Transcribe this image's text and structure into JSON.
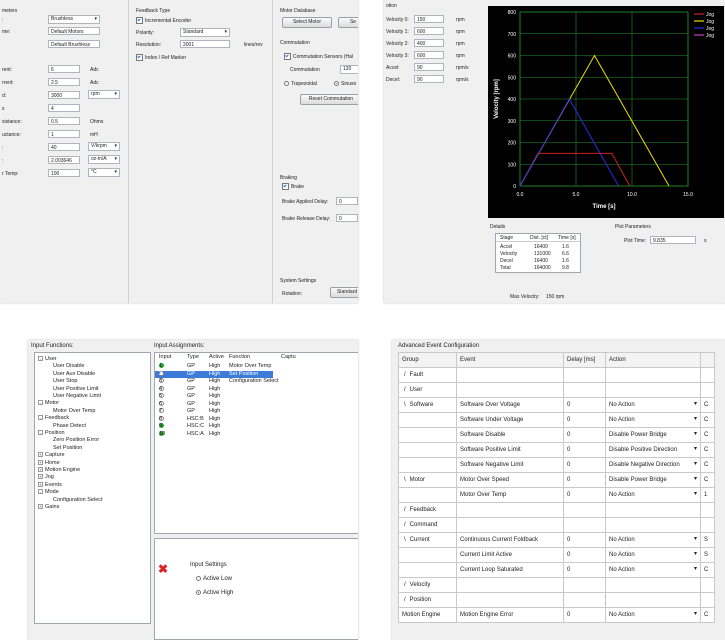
{
  "motor": {
    "parameters_header": "meters",
    "left_labels": [
      ":",
      "me:",
      "rent:",
      "rrent:",
      "d:",
      "s",
      "sistance:",
      "uctance:",
      ":",
      ":",
      "r Temp:"
    ],
    "fields": {
      "type": "Brushless",
      "name": "Default Motors",
      "model": "Default Brushless",
      "peak_current": "6",
      "cont_current": "2.5",
      "speed": "3000",
      "poles": "4",
      "resistance": "0.5",
      "inductance": "1",
      "ke": "40",
      "kt": "2.003646",
      "temp": "100"
    },
    "units": {
      "peak_current": "Adc",
      "cont_current": "Adc",
      "speed": "rpm",
      "resistance": "Ohms",
      "inductance": "mH",
      "ke": "V/krpm",
      "kt": "oz-in/A",
      "temp": "°C"
    },
    "feedback": {
      "header": "Feedback Type",
      "encoder_label": "Incremental Encoder",
      "polarity_label": "Polarity:",
      "polarity_value": "Standard",
      "resolution_label": "Resolution:",
      "resolution_value": "2001",
      "resolution_unit": "lines/rev",
      "index_label": "Index / Ref Marker"
    },
    "database": {
      "header": "Motor Database",
      "select_button": "Select Motor",
      "second_button": "Se"
    },
    "commutation": {
      "header": "Commutation",
      "sensors_label": "Commutation Sensors (Hal",
      "commutation_label": "Commutation",
      "commutation_value": "120",
      "trap_label": "Trapezoidal",
      "sin_label": "Sinuso",
      "reset_button": "Reset Commutation"
    },
    "braking": {
      "header": "Braking",
      "brake_label": "Brake",
      "applied_label": "Brake Applied Delay:",
      "applied_value": "0",
      "release_label": "Brake Release Delay:",
      "release_value": "0"
    },
    "system": {
      "header": "System Settings",
      "rotation_label": "Rotation:",
      "rotation_value": "Standard"
    }
  },
  "profile": {
    "header": "otion",
    "rows": [
      {
        "label": "Velocity 0:",
        "value": "150",
        "unit": "rpm"
      },
      {
        "label": "Velocity 1:",
        "value": "600",
        "unit": "rpm"
      },
      {
        "label": "Velocity 2:",
        "value": "400",
        "unit": "rpm"
      },
      {
        "label": "Velocity 3:",
        "value": "600",
        "unit": "rpm"
      },
      {
        "label": "Accel:",
        "value": "90",
        "unit": "rpm/s"
      },
      {
        "label": "Decel:",
        "value": "90",
        "unit": "rpm/s"
      }
    ],
    "details": {
      "header": "Details",
      "columns": [
        "Stage",
        "Dist. [ct]",
        "Time [s]"
      ],
      "rows": [
        [
          "Accel",
          "16400",
          "1.6"
        ],
        [
          "Velocity",
          "131000",
          "6.6"
        ],
        [
          "Decel",
          "16400",
          "1.6"
        ],
        [
          "Total",
          "164000",
          "9.8"
        ]
      ],
      "max_velocity_label": "Max Velocity:",
      "max_velocity_value": "150 rpm"
    },
    "plot_params": {
      "header": "Plot Parameters",
      "plot_time_label": "Plot Time:",
      "plot_time_value": "9.835",
      "plot_time_unit": "s"
    },
    "colors": {
      "plot_bg": "#000000",
      "grid": "#1f8f2a",
      "red": "#d02020",
      "yellow": "#e6e000",
      "blue": "#2a2ae6",
      "purple": "#c040c0"
    }
  },
  "chart_data": {
    "type": "line",
    "xlabel": "Time [s]",
    "ylabel": "Velocity [rpm]",
    "xlim": [
      0,
      15
    ],
    "ylim": [
      0,
      800
    ],
    "xticks": [
      "0.0",
      "5.0",
      "10.0",
      "15.0"
    ],
    "yticks": [
      "0",
      "100",
      "200",
      "300",
      "400",
      "500",
      "600",
      "700",
      "800"
    ],
    "grid": true,
    "legend_position": "top-right",
    "series": [
      {
        "name": "Jog",
        "color": "#d02020",
        "x": [
          0,
          1.6,
          8.2,
          9.8
        ],
        "y": [
          0,
          150,
          150,
          0
        ]
      },
      {
        "name": "Jog",
        "color": "#e6e000",
        "x": [
          0,
          6.65,
          13.3
        ],
        "y": [
          0,
          600,
          0
        ]
      },
      {
        "name": "Jog",
        "color": "#2a2ae6",
        "x": [
          0,
          4.4,
          8.8
        ],
        "y": [
          0,
          400,
          0
        ]
      },
      {
        "name": "Jog",
        "color": "#c040c0",
        "x": [],
        "y": []
      }
    ]
  },
  "io": {
    "functions_header": "Input Functions:",
    "assignments_header": "Input Assignments:",
    "tree": [
      {
        "label": "User",
        "level": 0,
        "exp": "-"
      },
      {
        "label": "User Disable",
        "level": 1
      },
      {
        "label": "User Aux Disable",
        "level": 1
      },
      {
        "label": "User Stop",
        "level": 1
      },
      {
        "label": "User Positive Limit",
        "level": 1
      },
      {
        "label": "User Negative Limit",
        "level": 1
      },
      {
        "label": "Motor",
        "level": 0,
        "exp": "-"
      },
      {
        "label": "Motor Over Temp",
        "level": 1
      },
      {
        "label": "Feedback",
        "level": 0,
        "exp": "-"
      },
      {
        "label": "Phase Detect",
        "level": 1
      },
      {
        "label": "Position",
        "level": 0,
        "exp": "-"
      },
      {
        "label": "Zero Position Error",
        "level": 1
      },
      {
        "label": "Set Position",
        "level": 1
      },
      {
        "label": "Capture",
        "level": 0,
        "exp": "+"
      },
      {
        "label": "Home",
        "level": 0,
        "exp": "+"
      },
      {
        "label": "Motion Engine",
        "level": 0,
        "exp": "+"
      },
      {
        "label": "Jog",
        "level": 0,
        "exp": "+"
      },
      {
        "label": "Events",
        "level": 0,
        "exp": "+"
      },
      {
        "label": "Mode",
        "level": 0,
        "exp": "-"
      },
      {
        "label": "Configuration Select",
        "level": 1
      },
      {
        "label": "Gains",
        "level": 0,
        "exp": "+"
      }
    ],
    "columns": [
      "Input",
      "Type",
      "Active",
      "Function",
      "Captu"
    ],
    "rows": [
      {
        "input": "1",
        "type": "GP",
        "active": "High",
        "function": "Motor Over Temp",
        "led": "green"
      },
      {
        "input": "2",
        "type": "GP",
        "active": "High",
        "function": "Set Position",
        "led": "off",
        "selected": true
      },
      {
        "input": "3",
        "type": "GP",
        "active": "High",
        "function": "Configuration Select",
        "led": "off"
      },
      {
        "input": "4",
        "type": "GP",
        "active": "High",
        "function": "",
        "led": "off"
      },
      {
        "input": "5",
        "type": "GP",
        "active": "High",
        "function": "",
        "led": "off"
      },
      {
        "input": "6",
        "type": "GP",
        "active": "High",
        "function": "",
        "led": "off"
      },
      {
        "input": "7",
        "type": "GP",
        "active": "High",
        "function": "",
        "led": "off"
      },
      {
        "input": "8",
        "type": "HSC:B",
        "active": "High",
        "function": "",
        "led": "off"
      },
      {
        "input": "9",
        "type": "HSC:C",
        "active": "High",
        "function": "",
        "led": "green"
      },
      {
        "input": "10",
        "type": "HSC:A",
        "active": "High",
        "function": "",
        "led": "green"
      }
    ],
    "settings": {
      "header": "Input Settings",
      "active_low": "Active Low",
      "active_high": "Active High"
    },
    "delete_icon": "red-x-icon"
  },
  "events": {
    "header": "Advanced Event Configuration",
    "columns": [
      "Group",
      "Event",
      "Delay [ms]",
      "Action",
      ""
    ],
    "rows": [
      {
        "group": "Fault",
        "marker": "/",
        "event": "",
        "delay": "",
        "action": "",
        "extra": ""
      },
      {
        "group": "User",
        "marker": "/",
        "event": "",
        "delay": "",
        "action": "",
        "extra": ""
      },
      {
        "group": "Software",
        "marker": "\\",
        "event": "Software Over Voltage",
        "delay": "0",
        "action": "No Action",
        "extra": "C"
      },
      {
        "group": "",
        "marker": "",
        "event": "Software Under Voltage",
        "delay": "0",
        "action": "No Action",
        "extra": "C"
      },
      {
        "group": "",
        "marker": "",
        "event": "Software Disable",
        "delay": "0",
        "action": "Disable Power Bridge",
        "extra": "C"
      },
      {
        "group": "",
        "marker": "",
        "event": "Software Positive Limit",
        "delay": "0",
        "action": "Disable Positive Direction",
        "extra": "C"
      },
      {
        "group": "",
        "marker": "",
        "event": "Software Negative Limit",
        "delay": "0",
        "action": "Disable Negative Direction",
        "extra": "C"
      },
      {
        "group": "Motor",
        "marker": "\\",
        "event": "Motor Over Speed",
        "delay": "0",
        "action": "Disable Power Bridge",
        "extra": "C"
      },
      {
        "group": "",
        "marker": "",
        "event": "Motor Over Temp",
        "delay": "0",
        "action": "No Action",
        "extra": "1"
      },
      {
        "group": "Feedback",
        "marker": "/",
        "event": "",
        "delay": "",
        "action": "",
        "extra": ""
      },
      {
        "group": "Command",
        "marker": "/",
        "event": "",
        "delay": "",
        "action": "",
        "extra": ""
      },
      {
        "group": "Current",
        "marker": "\\",
        "event": "Continuous Current Foldback",
        "delay": "0",
        "action": "No Action",
        "extra": "S"
      },
      {
        "group": "",
        "marker": "",
        "event": "Current Limit Active",
        "delay": "0",
        "action": "No Action",
        "extra": "S"
      },
      {
        "group": "",
        "marker": "",
        "event": "Current Loop Saturated",
        "delay": "0",
        "action": "No Action",
        "extra": "C"
      },
      {
        "group": "Velocity",
        "marker": "/",
        "event": "",
        "delay": "",
        "action": "",
        "extra": ""
      },
      {
        "group": "Position",
        "marker": "/",
        "event": "",
        "delay": "",
        "action": "",
        "extra": ""
      },
      {
        "group": "Motion Engine",
        "marker": "",
        "event": "Motion Engine Error",
        "delay": "0",
        "action": "No Action",
        "extra": "C"
      }
    ]
  }
}
